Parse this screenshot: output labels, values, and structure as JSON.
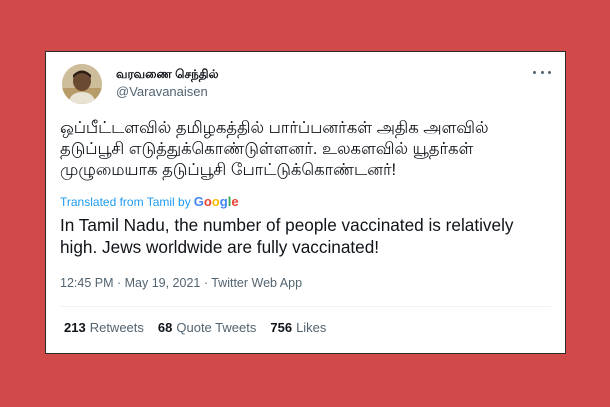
{
  "tweet": {
    "display_name": "வரவணை செந்தில்",
    "handle": "@Varavanaisen",
    "text_tamil": "ஒப்பீட்டளவில் தமிழகத்தில் பார்ப்பனர்கள் அதிக அளவில் தடுப்பூசி எடுத்துக்கொண்டுள்ளனர். உலகளவில் யூதர்கள் முழுமையாக தடுப்பூசி போட்டுக்கொண்டனர்!",
    "translated_from": "Translated from Tamil by",
    "google_letters": [
      "G",
      "o",
      "o",
      "g",
      "l",
      "e"
    ],
    "translation": "In Tamil Nadu, the number of people vaccinated is relatively high. Jews worldwide are fully vaccinated!",
    "timestamp": "12:45 PM · May 19, 2021 · Twitter Web App",
    "stats": {
      "retweets_count": "213",
      "retweets_label": "Retweets",
      "quote_tweets_count": "68",
      "quote_tweets_label": "Quote Tweets",
      "likes_count": "756",
      "likes_label": "Likes"
    }
  },
  "colors": {
    "background": "#cf4a48",
    "card": "#ffffff",
    "link": "#1d9bf0",
    "secondary_text": "#536471",
    "primary_text": "#0f1419",
    "google": [
      "#4285F4",
      "#EA4335",
      "#FBBC05",
      "#4285F4",
      "#34A853",
      "#EA4335"
    ]
  },
  "icons": {
    "more": "more-options-icon"
  }
}
